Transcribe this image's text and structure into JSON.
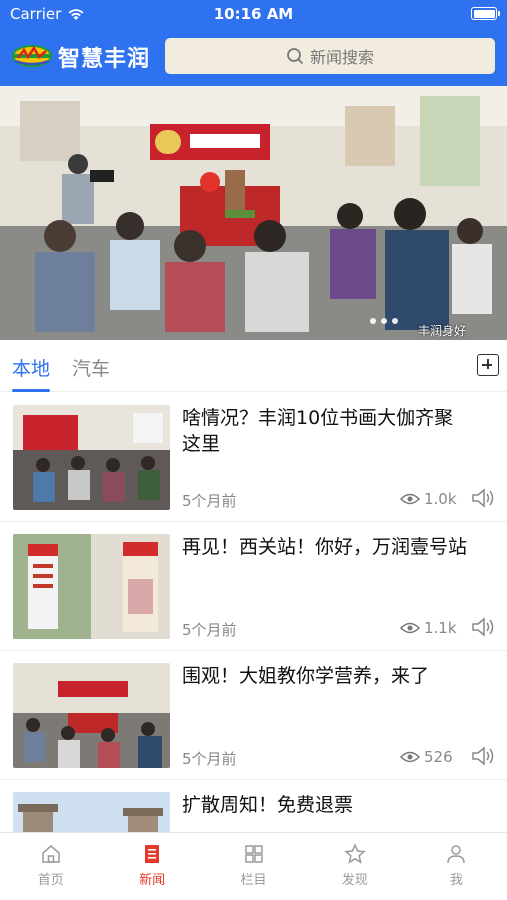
{
  "status_bar": {
    "carrier": "Carrier",
    "time": "10:16 AM"
  },
  "header": {
    "brand": "智慧丰润",
    "search_placeholder": "新闻搜索"
  },
  "banner": {
    "watermark": "丰润身好"
  },
  "tabs": [
    {
      "label": "本地",
      "active": true
    },
    {
      "label": "汽车",
      "active": false
    }
  ],
  "news": [
    {
      "title": "啥情况？丰润10位书画大伽齐聚这里",
      "time": "5个月前",
      "views": "1.0k"
    },
    {
      "title": "再见！西关站！你好，万润壹号站",
      "time": "5个月前",
      "views": "1.1k"
    },
    {
      "title": "围观！大姐教你学营养，来了",
      "time": "5个月前",
      "views": "526"
    },
    {
      "title": "扩散周知！免费退票",
      "time": "",
      "views": ""
    }
  ],
  "bottom_nav": [
    {
      "label": "首页",
      "icon": "home-icon",
      "active": false
    },
    {
      "label": "新闻",
      "icon": "news-icon",
      "active": true
    },
    {
      "label": "栏目",
      "icon": "grid-icon",
      "active": false
    },
    {
      "label": "发现",
      "icon": "star-icon",
      "active": false
    },
    {
      "label": "我",
      "icon": "person-icon",
      "active": false
    }
  ],
  "colors": {
    "primary": "#2f72f0",
    "active_nav": "#e23b2b",
    "search_bg": "#f2ecde"
  }
}
